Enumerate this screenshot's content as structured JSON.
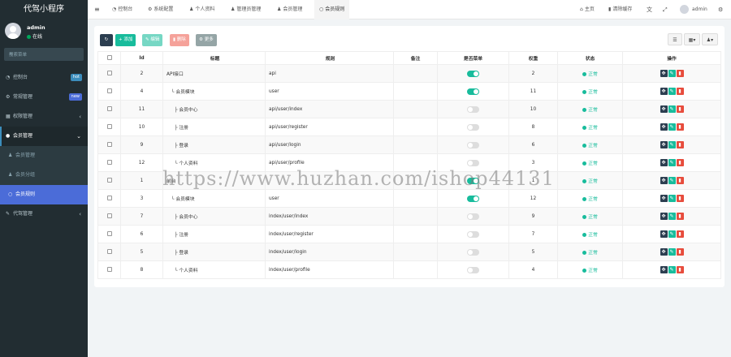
{
  "brand": "代驾小程序",
  "user": {
    "name": "admin",
    "status": "在线"
  },
  "search": {
    "placeholder": "搜索菜单"
  },
  "sidebar": {
    "items": [
      {
        "label": "控制台",
        "icon": "dashboard-icon",
        "badge": "hot",
        "badge_color": "#3c8dbc"
      },
      {
        "label": "常规管理",
        "icon": "cogs-icon",
        "badge": "new",
        "badge_color": "#4b6cd8"
      },
      {
        "label": "权限管理",
        "icon": "group-icon",
        "chevron": "‹"
      },
      {
        "label": "会员管理",
        "icon": "user-circle-icon",
        "chevron": "⌄"
      },
      {
        "label": "代驾管理",
        "icon": "wrench-icon",
        "chevron": "‹"
      }
    ],
    "sub": [
      {
        "label": "会员管理",
        "icon": "user-icon"
      },
      {
        "label": "会员分组",
        "icon": "users-icon"
      },
      {
        "label": "会员规则",
        "icon": "circle-icon"
      }
    ]
  },
  "topbar": {
    "menu_icon": "≡",
    "tabs": [
      {
        "label": "控制台",
        "icon": "dashboard-icon"
      },
      {
        "label": "系统配置",
        "icon": "cogs-icon"
      },
      {
        "label": "个人资料",
        "icon": "user-icon"
      },
      {
        "label": "管理员管理",
        "icon": "user-icon"
      },
      {
        "label": "会员管理",
        "icon": "user-icon"
      },
      {
        "label": "会员规则",
        "icon": "circle-icon"
      }
    ],
    "right": {
      "home": "主页",
      "clear_cache": "清除缓存",
      "admin": "admin"
    }
  },
  "toolbar": {
    "add": "添加",
    "edit": "编辑",
    "delete": "删除",
    "more": "更多",
    "colors": {
      "refresh": "#2c3e50",
      "add": "#18bc9c",
      "edit": "#76d7c4",
      "delete": "#f5a29a",
      "more": "#95a5a6"
    }
  },
  "table": {
    "headers": [
      "Id",
      "标题",
      "规则",
      "备注",
      "是否菜单",
      "权重",
      "状态",
      "操作"
    ],
    "rows": [
      {
        "id": "2",
        "title": "API接口",
        "rule": "api",
        "menu": true,
        "weight": "2",
        "status": "正常"
      },
      {
        "id": "4",
        "title": "└ 会员模块",
        "rule": "user",
        "menu": true,
        "weight": "11",
        "status": "正常"
      },
      {
        "id": "11",
        "title": "├ 会员中心",
        "rule": "api/user/index",
        "menu": false,
        "weight": "10",
        "status": "正常"
      },
      {
        "id": "10",
        "title": "├ 注册",
        "rule": "api/user/register",
        "menu": false,
        "weight": "8",
        "status": "正常"
      },
      {
        "id": "9",
        "title": "├ 登录",
        "rule": "api/user/login",
        "menu": false,
        "weight": "6",
        "status": "正常"
      },
      {
        "id": "12",
        "title": "└ 个人资料",
        "rule": "api/user/profile",
        "menu": false,
        "weight": "3",
        "status": "正常"
      },
      {
        "id": "1",
        "title": "前台",
        "rule": "",
        "menu": true,
        "weight": "1",
        "status": "正常"
      },
      {
        "id": "3",
        "title": "└ 会员模块",
        "rule": "user",
        "menu": true,
        "weight": "12",
        "status": "正常"
      },
      {
        "id": "7",
        "title": "├ 会员中心",
        "rule": "index/user/index",
        "menu": false,
        "weight": "9",
        "status": "正常"
      },
      {
        "id": "6",
        "title": "├ 注册",
        "rule": "index/user/register",
        "menu": false,
        "weight": "7",
        "status": "正常"
      },
      {
        "id": "5",
        "title": "├ 登录",
        "rule": "index/user/login",
        "menu": false,
        "weight": "5",
        "status": "正常"
      },
      {
        "id": "8",
        "title": "└ 个人资料",
        "rule": "index/user/profile",
        "menu": false,
        "weight": "4",
        "status": "正常"
      }
    ],
    "op_colors": {
      "drag": "#2c3e50",
      "edit": "#18bc9c",
      "del": "#e74c3c"
    }
  },
  "watermark": "https://www.huzhan.com/ishop44131"
}
